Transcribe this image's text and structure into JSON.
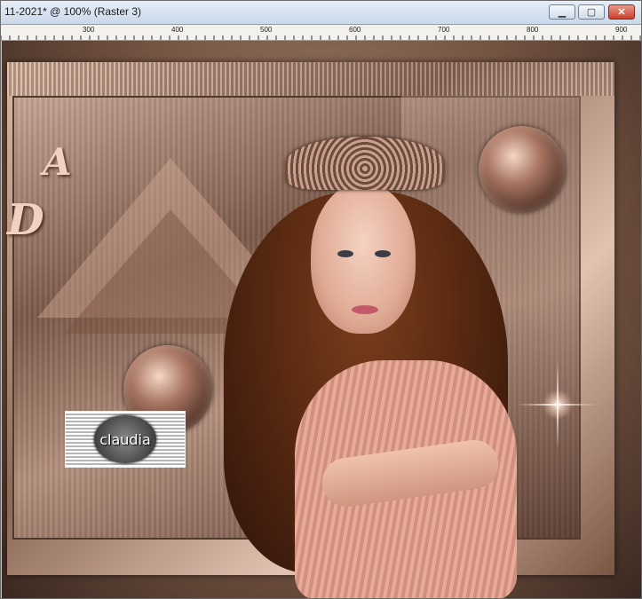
{
  "window": {
    "title": "11-2021* @ 100% (Raster 3)",
    "buttons": {
      "minimize_icon": "minimize-icon",
      "maximize_icon": "maximize-icon",
      "close_icon": "close-icon"
    }
  },
  "ruler": {
    "labels": [
      "300",
      "400",
      "500",
      "600",
      "700",
      "800",
      "900"
    ]
  },
  "canvas": {
    "letters": {
      "a": "A",
      "d": "D"
    },
    "watermark_text": "claudia"
  },
  "colors": {
    "title_gradient_top": "#e6eef8",
    "close_button": "#c8402c",
    "canvas_brown": "#7a5846",
    "dress_pink": "#e8ab9a"
  }
}
